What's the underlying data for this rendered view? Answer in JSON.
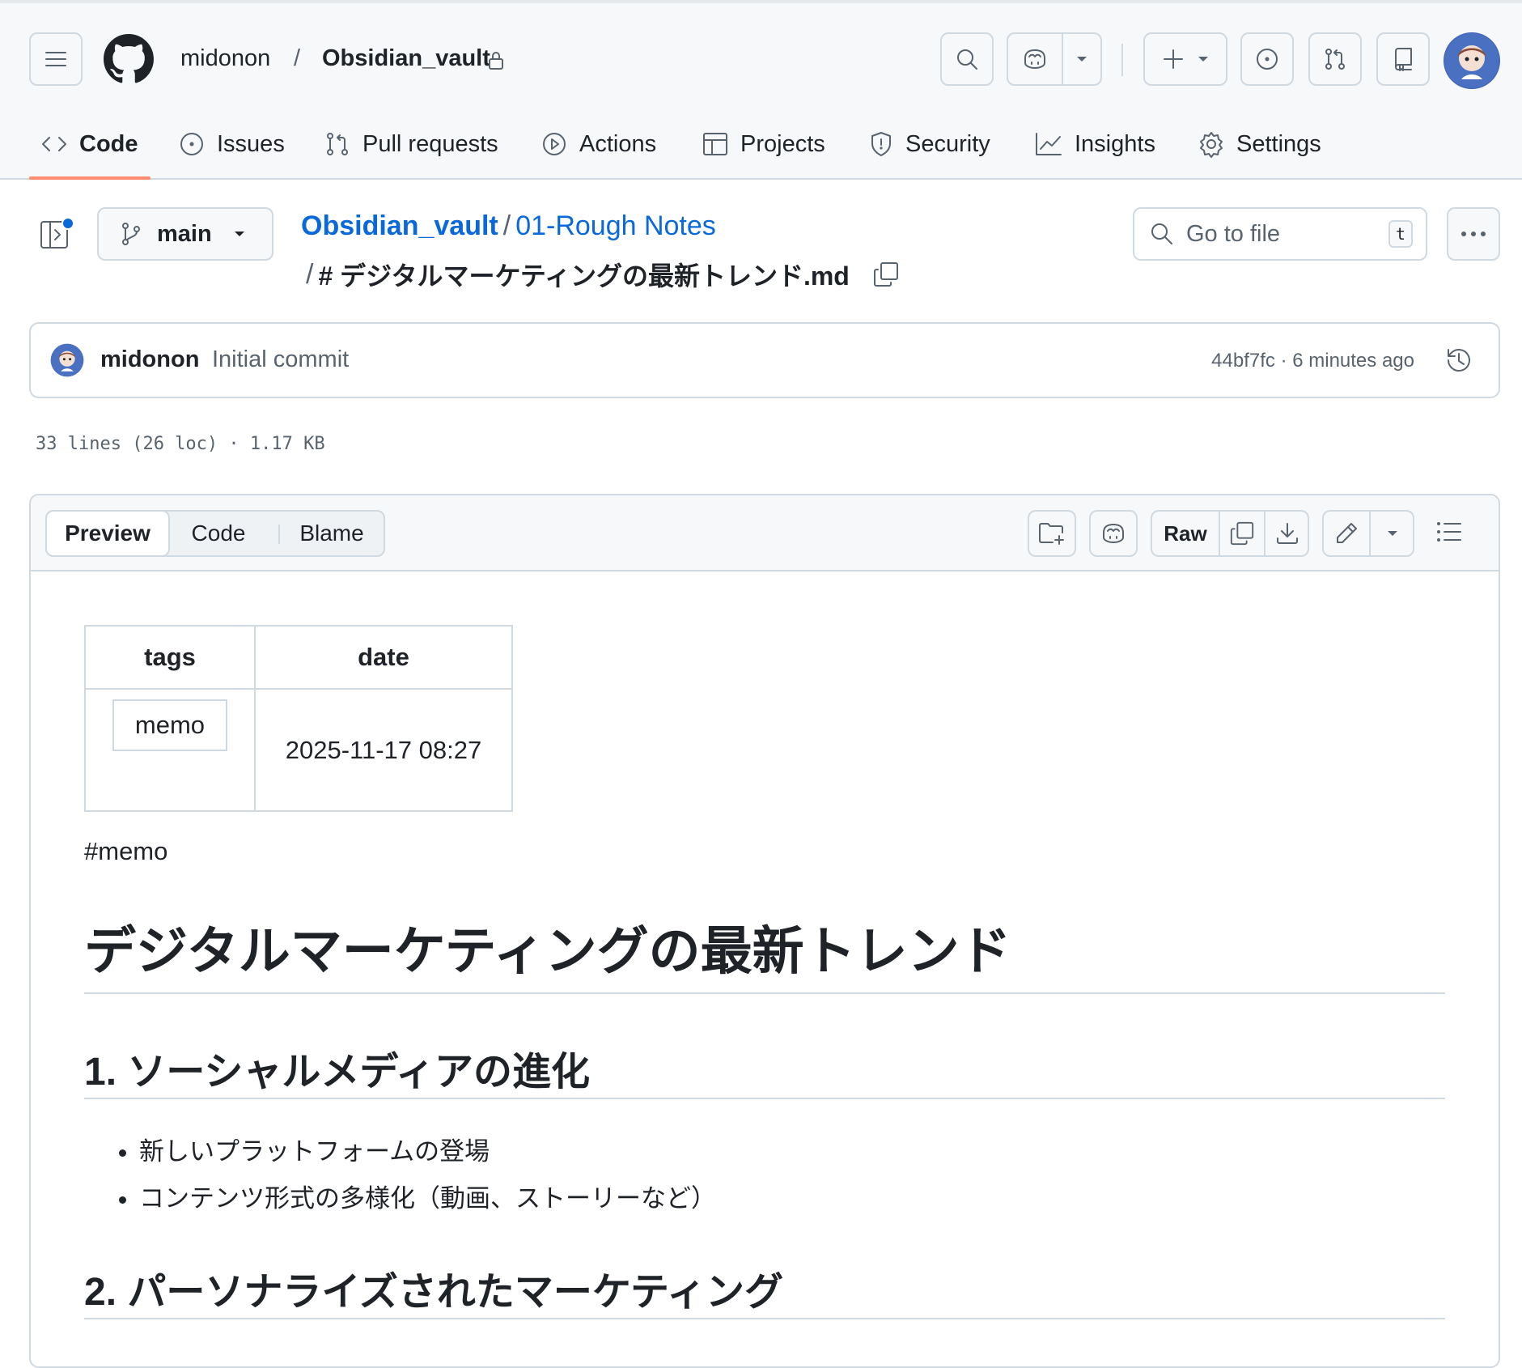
{
  "header": {
    "owner": "midonon",
    "separator": "/",
    "repo": "Obsidian_vault"
  },
  "tabs": [
    {
      "label": "Code",
      "icon": "code-icon"
    },
    {
      "label": "Issues",
      "icon": "issue-opened-icon"
    },
    {
      "label": "Pull requests",
      "icon": "git-pull-request-icon"
    },
    {
      "label": "Actions",
      "icon": "play-icon"
    },
    {
      "label": "Projects",
      "icon": "table-icon"
    },
    {
      "label": "Security",
      "icon": "shield-icon"
    },
    {
      "label": "Insights",
      "icon": "graph-icon"
    },
    {
      "label": "Settings",
      "icon": "gear-icon"
    }
  ],
  "file_header": {
    "branch": "main",
    "breadcrumb": {
      "repo": "Obsidian_vault",
      "sep": "/",
      "folder": "01-Rough Notes",
      "file_prefix": "/",
      "file": "# デジタルマーケティングの最新トレンド.md"
    },
    "goto_placeholder": "Go to file",
    "goto_shortcut": "t"
  },
  "commit": {
    "author": "midonon",
    "message": "Initial commit",
    "sha_time": "44bf7fc · 6 minutes ago"
  },
  "file_meta": "33 lines (26 loc) · 1.17 KB",
  "view_tabs": {
    "preview": "Preview",
    "code": "Code",
    "blame": "Blame",
    "raw": "Raw"
  },
  "markdown": {
    "frontmatter": {
      "headers": [
        "tags",
        "date"
      ],
      "tag": "memo",
      "date": "2025-11-17 08:27"
    },
    "hashtag": "#memo",
    "h1": "デジタルマーケティングの最新トレンド",
    "section1": {
      "title": "1. ソーシャルメディアの進化",
      "items": [
        "新しいプラットフォームの登場",
        "コンテンツ形式の多様化（動画、ストーリーなど）"
      ]
    },
    "section2": {
      "title": "2. パーソナライズされたマーケティング"
    }
  },
  "colors": {
    "accent_link": "#0969da",
    "tab_underline": "#fd8c73",
    "border": "#d1d9e0",
    "header_bg": "#f6f8fa",
    "notify_dot": "#0969da"
  }
}
